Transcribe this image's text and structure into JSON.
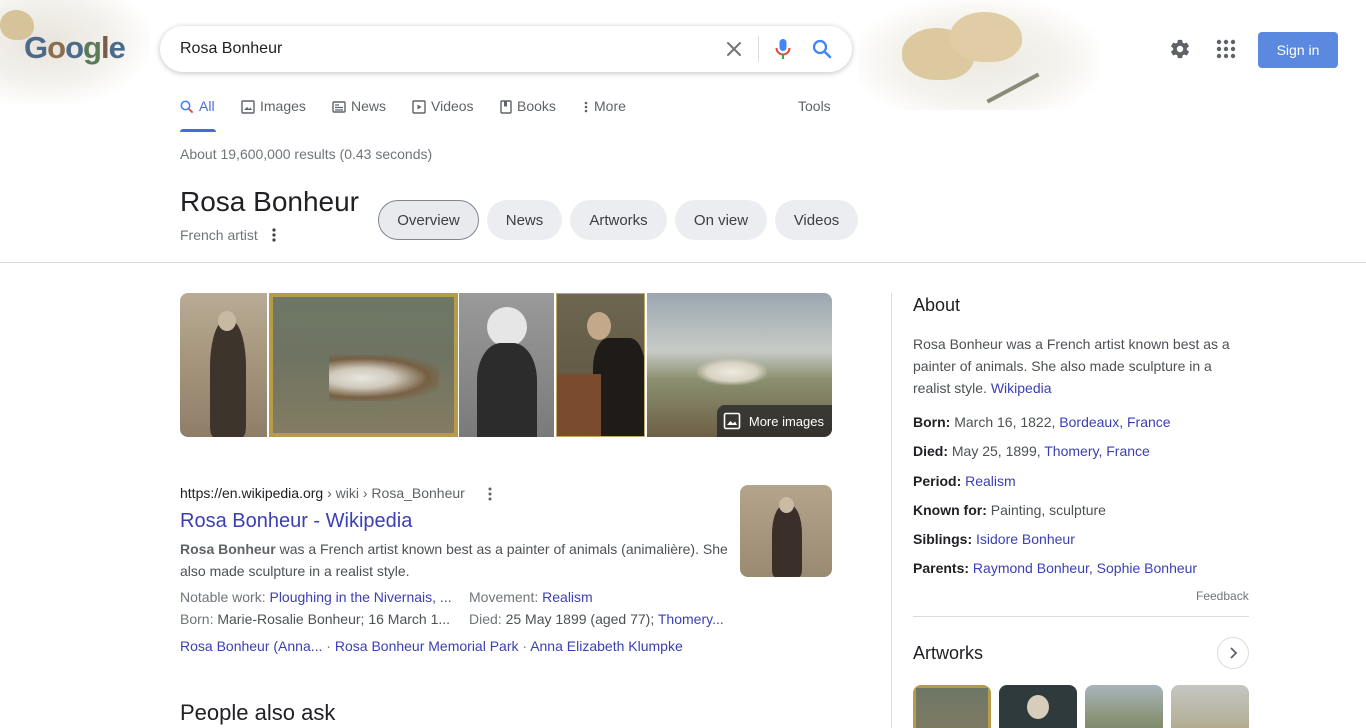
{
  "header": {
    "logo_text": "Google",
    "search": {
      "value": "Rosa Bonheur"
    },
    "icons": [
      "close-icon",
      "microphone-icon",
      "search-icon",
      "settings-gear-icon",
      "apps-grid-icon"
    ],
    "sign_in_label": "Sign in"
  },
  "tabs": [
    {
      "label": "All",
      "icon": "search-icon",
      "active": true
    },
    {
      "label": "Images",
      "icon": "image-icon"
    },
    {
      "label": "News",
      "icon": "newspaper-icon"
    },
    {
      "label": "Videos",
      "icon": "play-icon"
    },
    {
      "label": "Books",
      "icon": "book-icon"
    },
    {
      "label": "More",
      "icon": "more-vertical-icon"
    }
  ],
  "tools_label": "Tools",
  "result_stats": "About 19,600,000 results (0.43 seconds)",
  "entity": {
    "title": "Rosa Bonheur",
    "subtitle": "French artist",
    "chips": [
      "Overview",
      "News",
      "Artworks",
      "On view",
      "Videos"
    ]
  },
  "images": {
    "more_label": "More images"
  },
  "result": {
    "cite_domain": "https://en.wikipedia.org",
    "cite_path": " › wiki › Rosa_Bonheur",
    "title": "Rosa Bonheur - Wikipedia",
    "snippet_bold": "Rosa Bonheur",
    "snippet_rest": " was a French artist known best as a painter of animals (animalière). She also made sculpture in a realist style.",
    "facts": {
      "notable_label": "Notable work: ",
      "notable_value": "Ploughing in the Nivernais, ...",
      "movement_label": "Movement: ",
      "movement_value": "Realism",
      "born_label": "Born: ",
      "born_value": "Marie-Rosalie Bonheur; 16 March 1...",
      "died_label": "Died: ",
      "died_value": "25 May 1899 (aged 77); ",
      "died_link": "Thomery..."
    },
    "sitelinks": [
      "Rosa Bonheur (Anna...",
      "Rosa Bonheur Memorial Park",
      "Anna Elizabeth Klumpke"
    ],
    "sitelink_separator": " · "
  },
  "people_also_ask": "People also ask",
  "about": {
    "title": "About",
    "description": "Rosa Bonheur was a French artist known best as a painter of animals. She also made sculpture in a realist style. ",
    "source_link": "Wikipedia",
    "born_label": "Born:",
    "born_value": " March 16, 1822, ",
    "born_link": "Bordeaux, France",
    "died_label": "Died:",
    "died_value": " May 25, 1899, ",
    "died_link": "Thomery, France",
    "period_label": "Period:",
    "period_link": "Realism",
    "known_label": "Known for:",
    "known_value": " Painting, sculpture",
    "siblings_label": "Siblings:",
    "siblings_link": "Isidore Bonheur",
    "parents_label": "Parents:",
    "parents_link1": "Raymond Bonheur",
    "parents_sep": ", ",
    "parents_link2": "Sophie Bonheur",
    "feedback": "Feedback"
  },
  "artworks": {
    "title": "Artworks"
  },
  "colors": {
    "link": "#3b3fb6",
    "accent_blue": "#4a6bd6",
    "sign_in_bg": "#5b89e0"
  }
}
